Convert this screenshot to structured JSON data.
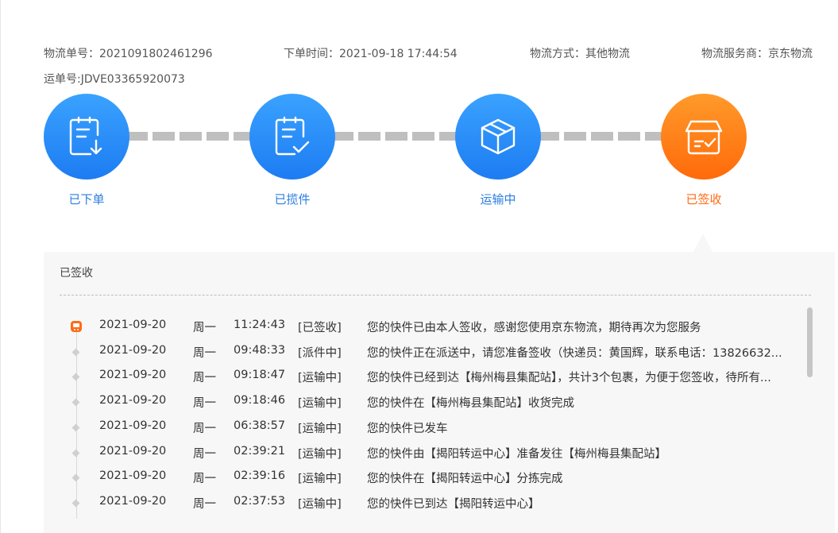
{
  "header": {
    "order_no_label": "物流单号：",
    "order_no": "2021091802461296",
    "order_time_label": "下单时间：",
    "order_time": "2021-09-18 17:44:54",
    "method_label": "物流方式：",
    "method": "其他物流",
    "provider_label": "物流服务商：",
    "provider": "京东物流",
    "waybill_label": "运单号:",
    "waybill": "JDVE03365920073"
  },
  "steps": [
    {
      "label": "已下单",
      "icon": "order-placed-icon",
      "state": "reached"
    },
    {
      "label": "已揽件",
      "icon": "picked-up-icon",
      "state": "reached"
    },
    {
      "label": "运输中",
      "icon": "package-box-icon",
      "state": "reached"
    },
    {
      "label": "已签收",
      "icon": "signed-icon",
      "state": "current"
    }
  ],
  "panel": {
    "title": "已签收"
  },
  "events": [
    {
      "date": "2021-09-20",
      "weekday": "周一",
      "time": "11:24:43",
      "status": "[已签收]",
      "desc": "您的快件已由本人签收，感谢您使用京东物流，期待再次为您服务",
      "marker": "truck-icon"
    },
    {
      "date": "2021-09-20",
      "weekday": "周一",
      "time": "09:48:33",
      "status": "[派件中]",
      "desc": "您的快件正在派送中，请您准备签收（快递员：黄国辉，联系电话：13826632...",
      "marker": "diamond-dot"
    },
    {
      "date": "2021-09-20",
      "weekday": "周一",
      "time": "09:18:47",
      "status": "[运输中]",
      "desc": "您的快件已经到达【梅州梅县集配站】，共计3个包裹，为便于您签收，待所有...",
      "marker": "diamond-dot"
    },
    {
      "date": "2021-09-20",
      "weekday": "周一",
      "time": "09:18:46",
      "status": "[运输中]",
      "desc": "您的快件在【梅州梅县集配站】收货完成",
      "marker": "diamond-dot"
    },
    {
      "date": "2021-09-20",
      "weekday": "周一",
      "time": "06:38:57",
      "status": "[运输中]",
      "desc": "您的快件已发车",
      "marker": "diamond-dot"
    },
    {
      "date": "2021-09-20",
      "weekday": "周一",
      "time": "02:39:21",
      "status": "[运输中]",
      "desc": "您的快件由【揭阳转运中心】准备发往【梅州梅县集配站】",
      "marker": "diamond-dot"
    },
    {
      "date": "2021-09-20",
      "weekday": "周一",
      "time": "02:39:16",
      "status": "[运输中]",
      "desc": "您的快件在【揭阳转运中心】分拣完成",
      "marker": "diamond-dot"
    },
    {
      "date": "2021-09-20",
      "weekday": "周一",
      "time": "02:37:53",
      "status": "[运输中]",
      "desc": "您的快件已到达【揭阳转运中心】",
      "marker": "diamond-dot"
    }
  ],
  "colors": {
    "step_blue": "#1d7cf2",
    "step_orange": "#ff6a0a",
    "label_blue": "#2b7de0",
    "label_orange": "#ff6a14"
  }
}
